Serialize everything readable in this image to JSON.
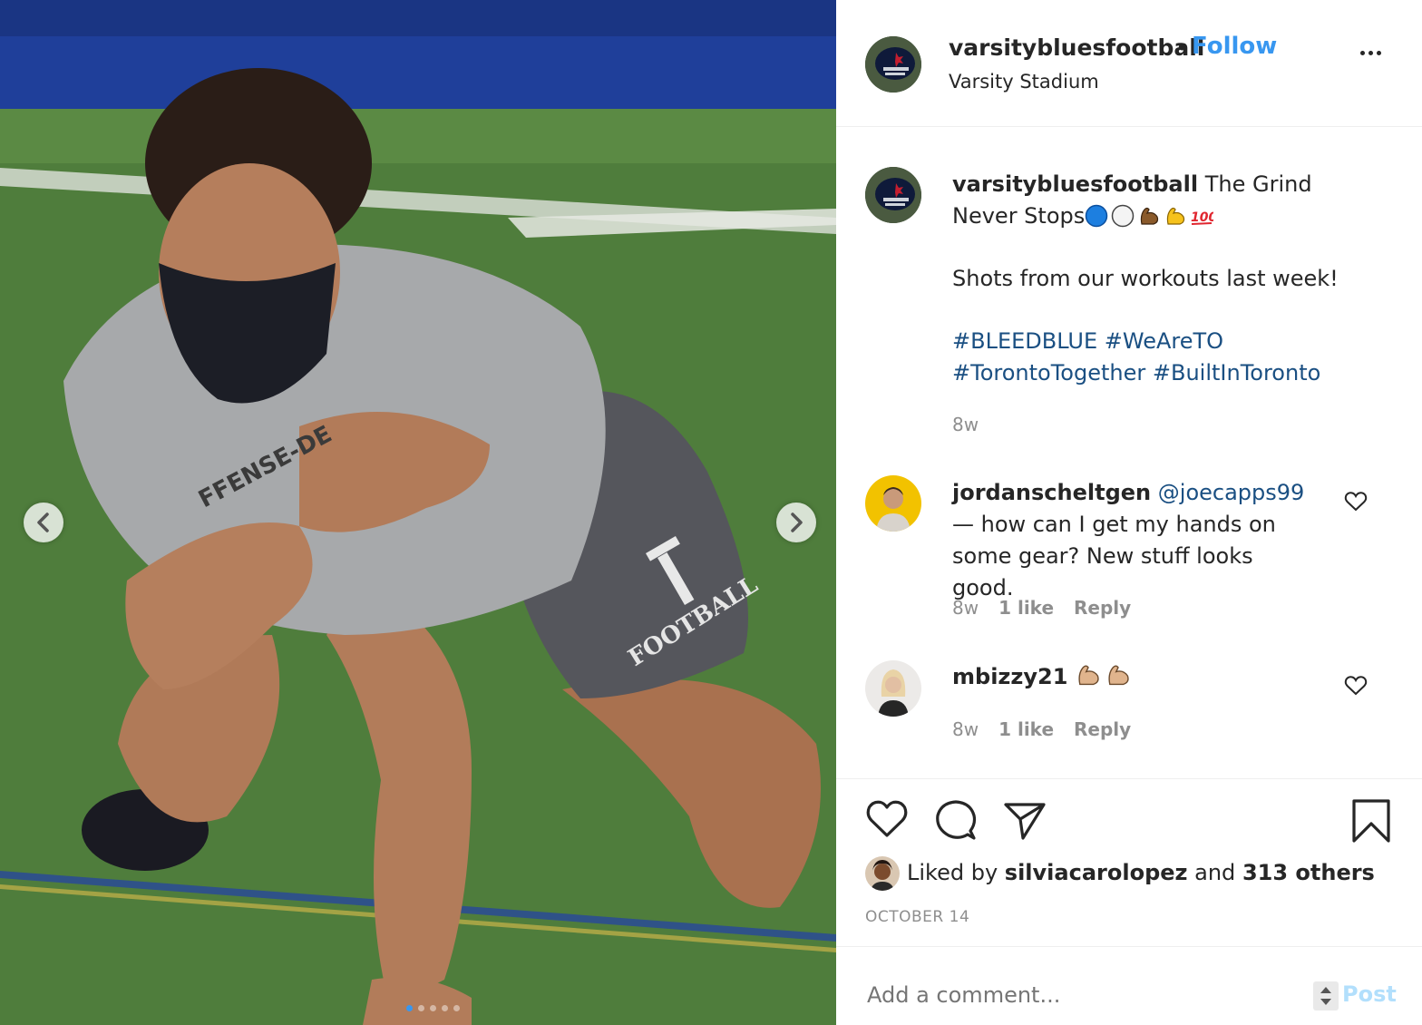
{
  "post": {
    "username": "varsitybluesfootball",
    "separator": "•",
    "follow_label": "Follow",
    "location": "Varsity Stadium",
    "more_icon": "more-horizontal-icon"
  },
  "caption": {
    "username": "varsitybluesfootball",
    "text_line1": "The Grind Never Stops",
    "emojis": [
      "blue-circle-emoji",
      "white-circle-emoji",
      "flexed-biceps-brown-emoji",
      "flexed-biceps-yellow-emoji",
      "hundred-points-emoji"
    ],
    "text_line2": "Shots from our workouts last week!",
    "hashtags": [
      "#BLEEDBLUE",
      "#WeAreTO",
      "#TorontoTogether",
      "#BuiltInToronto"
    ],
    "time": "8w"
  },
  "comments": [
    {
      "username": "jordanscheltgen",
      "mention": "@joecapps99",
      "text": " — how can I get my hands on some gear? New stuff looks good.",
      "time": "8w",
      "likes": "1 like",
      "reply": "Reply"
    },
    {
      "username": "mbizzy21",
      "text": "",
      "emojis": [
        "flexed-biceps-light-emoji",
        "flexed-biceps-light-emoji"
      ],
      "time": "8w",
      "likes": "1 like",
      "reply": "Reply"
    }
  ],
  "likes": {
    "prefix": "Liked by",
    "user": "silviacarolopez",
    "joiner": "and",
    "others": "313 others"
  },
  "date": "OCTOBER 14",
  "comment_box": {
    "placeholder": "Add a comment...",
    "post_label": "Post"
  },
  "colors": {
    "accent": "#3897f0",
    "hashtag": "#1a4f82",
    "muted": "#8e8e8e",
    "post_disabled": "#b2dffc"
  },
  "carousel": {
    "slides": 5,
    "active": 1
  }
}
